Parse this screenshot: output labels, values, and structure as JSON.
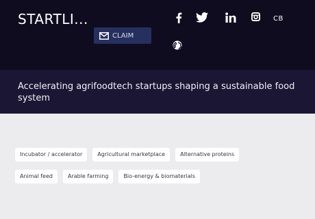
{
  "header": {
    "title": "STARTLI...",
    "claim_label": "CLAIM",
    "profile_initials": "CB"
  },
  "social_icons": [
    "facebook-icon",
    "twitter-icon",
    "linkedin-icon",
    "instagram-icon",
    "globe-icon"
  ],
  "tagline": "Accelerating agrifoodtech startups shaping a sustainable food system",
  "tags": [
    [
      "Incubator / accelerator",
      "Agricultural marketplace",
      "Alternative proteins"
    ],
    [
      "Animal feed",
      "Arable farming",
      "Bio-energy & biomaterials"
    ]
  ],
  "colors": {
    "header_bg": "#0f0c1f",
    "tagline_band_bg": "#1a1634",
    "claim_bg": "#26305f",
    "page_bg": "#ececee",
    "tag_bg": "#ffffff"
  }
}
